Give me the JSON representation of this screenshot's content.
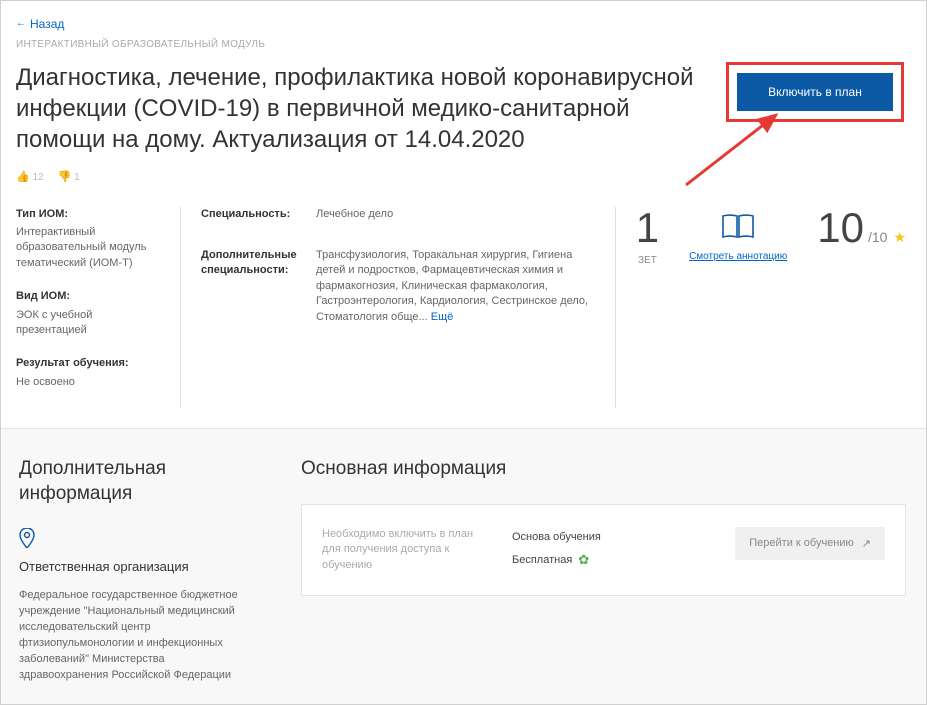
{
  "nav": {
    "back": "Назад"
  },
  "header": {
    "category": "ИНТЕРАКТИВНЫЙ ОБРАЗОВАТЕЛЬНЫЙ МОДУЛЬ",
    "title": "Диагностика, лечение, профилактика новой коронавирусной инфекции (COVID-19) в первичной медико-санитарной помощи на дому. Актуализация от 14.04.2020",
    "cta": "Включить в план",
    "likes": "12",
    "dislikes": "1"
  },
  "meta": {
    "iom_type_label": "Тип ИОМ:",
    "iom_type_value": "Интерактивный образовательный модуль тематический (ИОМ-Т)",
    "iom_kind_label": "Вид ИОМ:",
    "iom_kind_value": "ЭОК с учебной презентацией",
    "result_label": "Результат обучения:",
    "result_value": "Не освоено",
    "speciality_label": "Специальность:",
    "speciality_value": "Лечебное дело",
    "add_spec_label": "Дополнительные специальности:",
    "add_spec_value": "Трансфузиология, Торакальная хирургия, Гигиена детей и подростков, Фармацевтическая химия и фармакогнозия, Клиническая фармакология, Гастроэнтерология, Кардиология, Сестринское дело, Стоматология обще... ",
    "more": "Ещё"
  },
  "stats": {
    "zet_value": "1",
    "zet_label": "ЗЕТ",
    "annotation_link": "Смотреть аннотацию",
    "rating": "10",
    "rating_max": "/10"
  },
  "lower": {
    "left_heading": "Дополнительная информация",
    "org_label": "Ответственная организация",
    "org_value": "Федеральное государственное бюджетное учреждение \"Национальный медицинский исследовательский центр фтизиопульмонологии и инфекционных заболеваний\" Министерства здравоохранения Российской Федерации",
    "right_heading": "Основная информация",
    "access_note": "Необходимо включить в план для получения доступа к обучению",
    "basis_label": "Основа обучения",
    "free_label": "Бесплатная",
    "goto_button": "Перейти к обучению"
  }
}
